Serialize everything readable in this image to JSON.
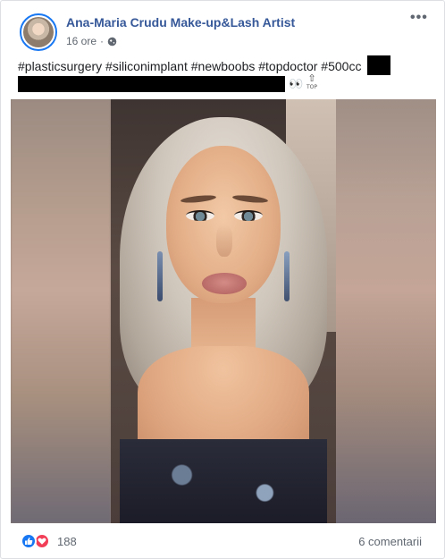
{
  "post": {
    "author": "Ana-Maria Crudu Make-up&Lash Artist",
    "time": "16 ore",
    "separator": "·",
    "audience_icon": "globe-icon",
    "more_icon": "more-options-icon",
    "hashtags": "#plasticsurgery #siliconimplant #newboobs #topdoctor #500cc",
    "emoji": "👀",
    "top_badge": "TOP",
    "redacted": true
  },
  "media": {
    "type": "photo",
    "description_icon": "portrait-photo"
  },
  "footer": {
    "reactions": [
      "like",
      "love"
    ],
    "reaction_count": "188",
    "comments": "6 comentarii"
  },
  "colors": {
    "author_link": "#365899",
    "meta_text": "#606770",
    "like_blue": "#1877f2",
    "love_red": "#f33e58"
  }
}
